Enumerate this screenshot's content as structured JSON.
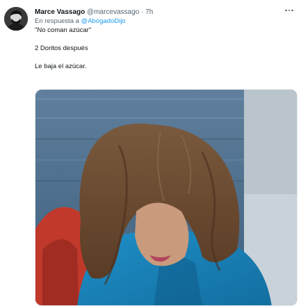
{
  "tweet": {
    "display_name": "Marce Vassago",
    "handle": "@marcevassago",
    "separator": "·",
    "time": "7h",
    "reply_prefix": "En respuesta a",
    "reply_to": "@AbogadoDijo",
    "lines": [
      "\"No coman azúcar\"",
      "2 Doritos después",
      "Le baja el azúcar."
    ]
  },
  "icons": {
    "more": "more-horizontal-icon",
    "avatar": "avatar-image"
  },
  "colors": {
    "text": "#0f1419",
    "secondary": "#536471",
    "link": "#1d9bf0"
  }
}
